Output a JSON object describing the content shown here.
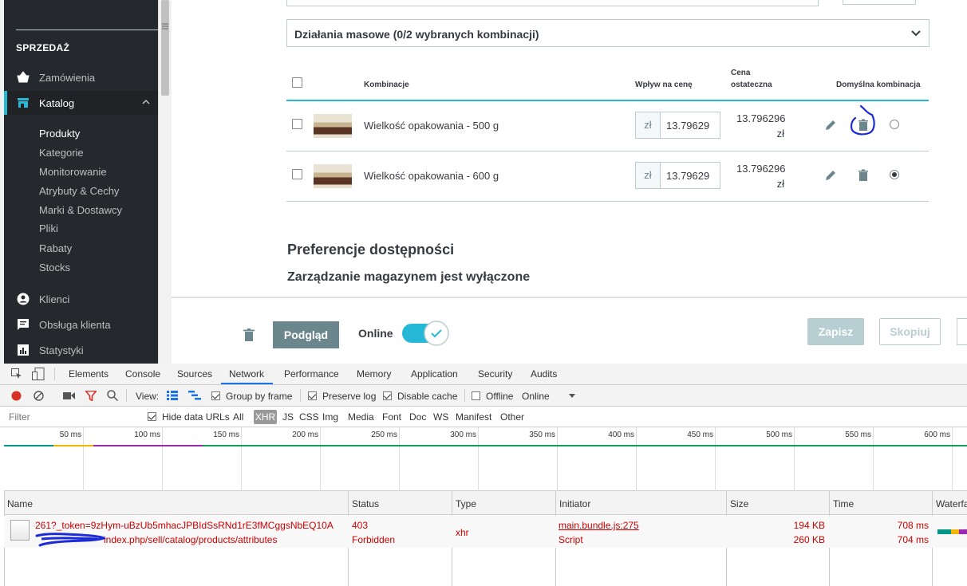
{
  "sidebar": {
    "section_sales": "SPRZEDAŻ",
    "items": [
      {
        "label": "Zamówienia"
      },
      {
        "label": "Katalog"
      },
      {
        "label": "Klienci"
      },
      {
        "label": "Obsługa klienta"
      },
      {
        "label": "Statystyki"
      }
    ],
    "catalog_sub": [
      "Produkty",
      "Kategorie",
      "Monitorowanie",
      "Atrybuty & Cechy",
      "Marki & Dostawcy",
      "Pliki",
      "Rabaty",
      "Stocks"
    ]
  },
  "combinations": {
    "bulk_actions": "Działania masowe (0/2 wybranych kombinacji)",
    "headers": {
      "combination": "Kombinacje",
      "price_impact": "Wpływ na cenę",
      "final_price_line1": "Cena",
      "final_price_line2": "ostateczna",
      "default": "Domyślna kombinacja"
    },
    "rows": [
      {
        "name": "Wielkość opakowania - 500 g",
        "currency": "zł",
        "impact": "13.79629",
        "final_value": "13.796296",
        "final_currency": "zł",
        "default": false
      },
      {
        "name": "Wielkość opakowania - 600 g",
        "currency": "zł",
        "impact": "13.79629",
        "final_value": "13.796296",
        "final_currency": "zł",
        "default": true
      }
    ]
  },
  "availability": {
    "title": "Preferencje dostępności",
    "subtitle": "Zarządzanie magazynem jest wyłączone"
  },
  "footer": {
    "preview": "Podgląd",
    "online": "Online",
    "save": "Zapisz",
    "copy": "Skopiuj"
  },
  "devtools": {
    "tabs": [
      "Elements",
      "Console",
      "Sources",
      "Network",
      "Performance",
      "Memory",
      "Application",
      "Security",
      "Audits"
    ],
    "selected_tab": "Network",
    "toolbar": {
      "view": "View:",
      "group_by_frame": "Group by frame",
      "preserve_log": "Preserve log",
      "disable_cache": "Disable cache",
      "offline": "Offline",
      "throttle": "Online"
    },
    "filter": {
      "placeholder": "Filter",
      "hide_data_urls": "Hide data URLs",
      "types": [
        "All",
        "XHR",
        "JS",
        "CSS",
        "Img",
        "Media",
        "Font",
        "Doc",
        "WS",
        "Manifest",
        "Other"
      ],
      "selected_type": "XHR"
    },
    "timeline_ticks": [
      "50 ms",
      "100 ms",
      "150 ms",
      "200 ms",
      "250 ms",
      "300 ms",
      "350 ms",
      "400 ms",
      "450 ms",
      "500 ms",
      "550 ms",
      "600 ms"
    ],
    "columns": [
      "Name",
      "Status",
      "Type",
      "Initiator",
      "Size",
      "Time",
      "Waterfall"
    ],
    "request": {
      "name_line1": "261?_token=9zHym-uBzUb5mhacJPBIdSsRNd1rE3fMCggsNbEQ10A",
      "name_line2": "index.php/sell/catalog/products/attributes",
      "status_code": "403",
      "status_text": "Forbidden",
      "type": "xhr",
      "initiator": "main.bundle.js:275",
      "initiator_type": "Script",
      "size_transferred": "194 KB",
      "size_resource": "260 KB",
      "time_total": "708 ms",
      "time_latency": "704 ms"
    }
  }
}
